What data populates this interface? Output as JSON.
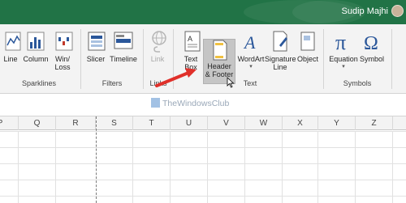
{
  "titlebar": {
    "user_name": "Sudip Majhi",
    "color": "#217346"
  },
  "ribbon": {
    "buttons": [
      {
        "label": "Line",
        "icon": "sparkline-line-icon"
      },
      {
        "label": "Column",
        "icon": "sparkline-column-icon"
      },
      {
        "label": "Win/\nLoss",
        "icon": "sparkline-winloss-icon"
      },
      {
        "label": "Slicer",
        "icon": "slicer-icon"
      },
      {
        "label": "Timeline",
        "icon": "timeline-icon"
      },
      {
        "label": "Link",
        "icon": "link-icon",
        "disabled": true
      },
      {
        "label": "Text\nBox",
        "icon": "text-box-icon"
      },
      {
        "label": "Header\n& Footer",
        "icon": "header-footer-icon",
        "highlighted": true
      },
      {
        "label": "WordArt",
        "icon": "wordart-icon",
        "dropdown": true
      },
      {
        "label": "Signature\nLine",
        "icon": "signature-line-icon",
        "dropdown": true
      },
      {
        "label": "Object",
        "icon": "object-icon"
      },
      {
        "label": "Equation",
        "icon": "equation-icon",
        "dropdown": true
      },
      {
        "label": "Symbol",
        "icon": "symbol-icon"
      }
    ],
    "groups": [
      "Sparklines",
      "Filters",
      "Links",
      "Text",
      "Symbols"
    ]
  },
  "watermark": "TheWindowsClub",
  "columns": [
    "P",
    "Q",
    "R",
    "S",
    "T",
    "U",
    "V",
    "W",
    "X",
    "Y",
    "Z"
  ]
}
